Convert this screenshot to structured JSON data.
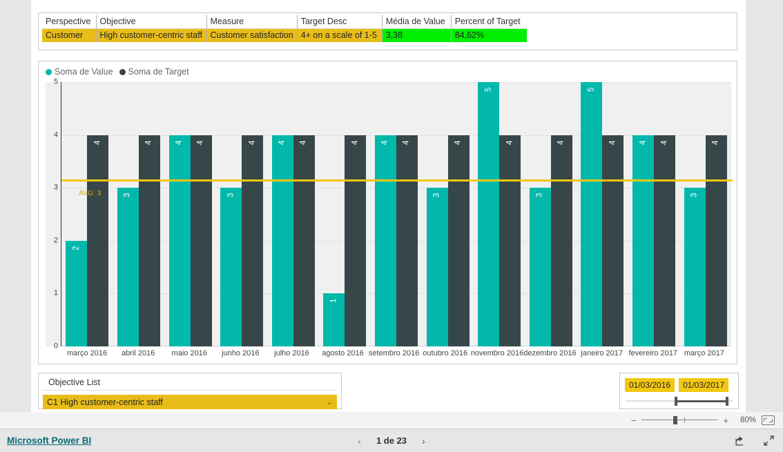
{
  "kpi_table": {
    "columns": [
      "Perspective",
      "Objective",
      "Measure",
      "Target Desc",
      "Média de Value",
      "Percent of Target"
    ],
    "row": {
      "perspective": "Customer",
      "objective": "High customer-centric staff",
      "measure": "Customer satisfaction",
      "target_desc": "4+ on a scale of 1-5",
      "media_de_value": "3,38",
      "percent_of_target": "84,62%"
    },
    "colors": {
      "highlight": "#e8bd1a",
      "status_good": "#00ee00"
    }
  },
  "chart_data": {
    "type": "bar",
    "title": "",
    "xlabel": "",
    "ylabel": "",
    "ylim": [
      0,
      5
    ],
    "yticks": [
      "0",
      "1",
      "2",
      "3",
      "4",
      "5"
    ],
    "grid": true,
    "legend_position": "top-left",
    "categories": [
      "março 2016",
      "abril 2016",
      "maio 2016",
      "junho 2016",
      "julho 2016",
      "agosto 2016",
      "setembro 2016",
      "outubro 2016",
      "novembro 2016",
      "dezembro 2016",
      "janeiro 2017",
      "fevereiro 2017",
      "março 2017"
    ],
    "series": [
      {
        "name": "Soma de Value",
        "color": "#01b8aa",
        "values": [
          2,
          3,
          4,
          3,
          4,
          1,
          4,
          3,
          5,
          3,
          5,
          4,
          3
        ]
      },
      {
        "name": "Soma de Target",
        "color": "#374649",
        "values": [
          4,
          4,
          4,
          4,
          4,
          4,
          4,
          4,
          4,
          4,
          4,
          4,
          4
        ]
      }
    ],
    "reference_line": {
      "label": "AVG: 3",
      "value": 3.15,
      "color": "#f2c811"
    }
  },
  "objective_slicer": {
    "title": "Objective List",
    "selected": "C1 High customer-centric staff",
    "chevron": "chevron-down-icon"
  },
  "date_slicer": {
    "start": "01/03/2016",
    "end": "01/03/2017"
  },
  "statusbar": {
    "minus": "−",
    "plus": "+",
    "zoom_level": "80%",
    "fit_icon": "fit-to-page-icon"
  },
  "footer": {
    "brand": "Microsoft Power BI",
    "prev": "‹",
    "next": "›",
    "page_text": "1 de 23",
    "share_icon": "share-icon",
    "fullscreen_icon": "fullscreen-icon"
  }
}
